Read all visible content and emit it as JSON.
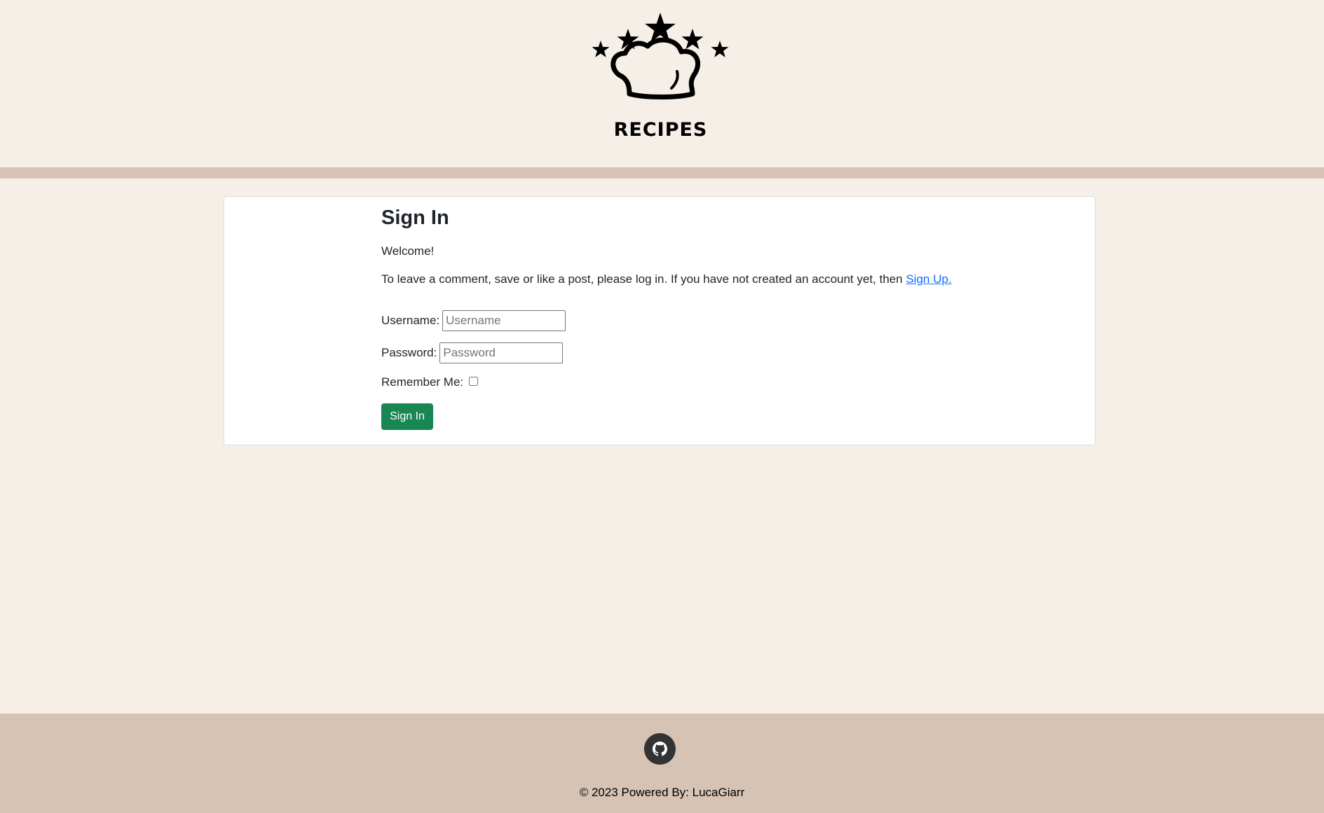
{
  "header": {
    "logo_text": "RECIPES"
  },
  "signin": {
    "title": "Sign In",
    "welcome": "Welcome!",
    "info_text": "To leave a comment, save or like a post, please log in. If you have not created an account yet, then ",
    "signup_link": "Sign Up.",
    "username_label": "Username:",
    "username_placeholder": "Username",
    "password_label": "Password:",
    "password_placeholder": "Password",
    "remember_label": "Remember Me:",
    "remember_checked": false,
    "submit_label": "Sign In"
  },
  "footer": {
    "github_icon": "github-icon",
    "copyright": "© 2023 Powered By: LucaGiarr"
  },
  "colors": {
    "page_background": "#f5efe8",
    "accent_bar": "#d6c3b4",
    "button": "#198754",
    "link": "#0d6efd"
  }
}
